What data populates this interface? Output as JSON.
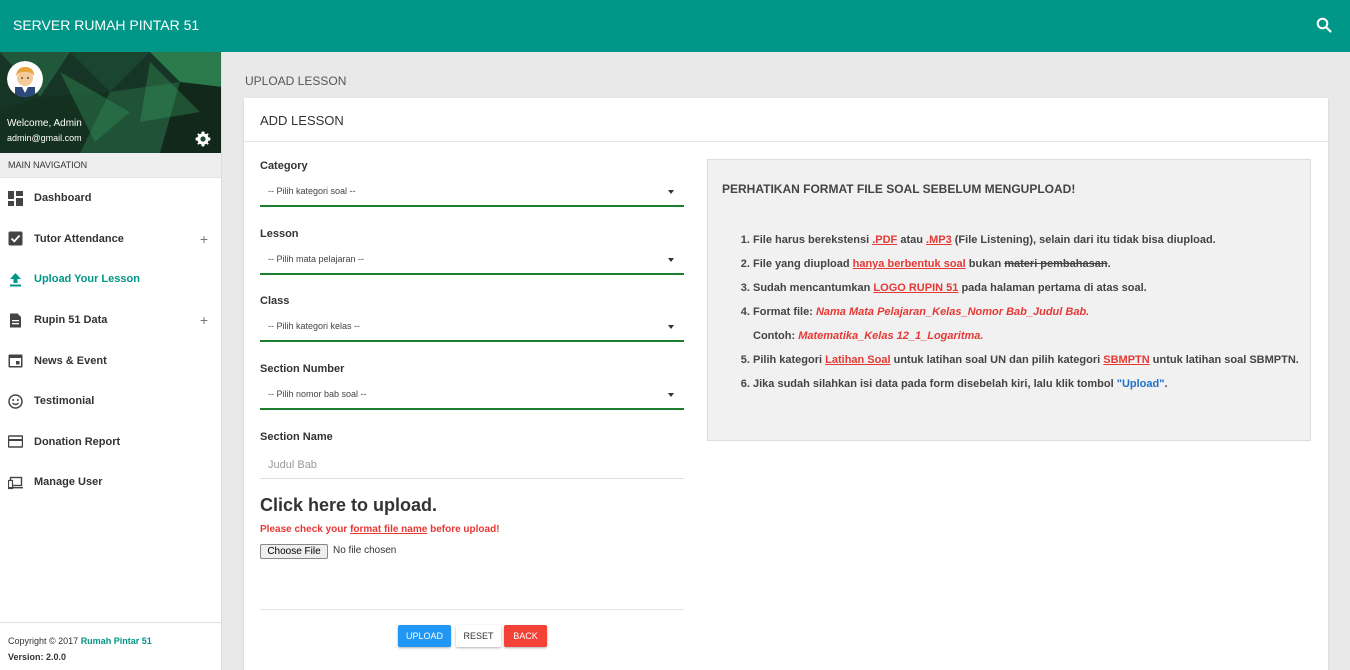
{
  "app": {
    "title": "SERVER RUMAH PINTAR 51"
  },
  "user": {
    "welcome": "Welcome, Admin",
    "email": "admin@gmail.com"
  },
  "nav": {
    "header": "MAIN NAVIGATION",
    "items": [
      {
        "label": "Dashboard",
        "icon": "dashboard-icon",
        "expandable": false
      },
      {
        "label": "Tutor Attendance",
        "icon": "checkbox-icon",
        "expandable": true
      },
      {
        "label": "Upload Your Lesson",
        "icon": "upload-icon",
        "expandable": false,
        "active": true
      },
      {
        "label": "Rupin 51 Data",
        "icon": "document-icon",
        "expandable": true
      },
      {
        "label": "News & Event",
        "icon": "calendar-icon",
        "expandable": false
      },
      {
        "label": "Testimonial",
        "icon": "smiley-icon",
        "expandable": false
      },
      {
        "label": "Donation Report",
        "icon": "card-icon",
        "expandable": false
      },
      {
        "label": "Manage User",
        "icon": "devices-icon",
        "expandable": false
      }
    ],
    "plus": "+"
  },
  "footer": {
    "copyright": "Copyright © 2017 ",
    "brand": "Rumah Pintar 51",
    "version": "Version: 2.0.0"
  },
  "page": {
    "title": "UPLOAD LESSON"
  },
  "card": {
    "title": "ADD LESSON"
  },
  "form": {
    "category_label": "Category",
    "category_value": "-- Pilih kategori soal --",
    "lesson_label": "Lesson",
    "lesson_value": "-- Pilih mata pelajaran --",
    "class_label": "Class",
    "class_value": "-- Pilih kategori kelas --",
    "section_number_label": "Section Number",
    "section_number_value": "-- Pilih nomor bab soal --",
    "section_name_label": "Section Name",
    "section_name_placeholder": "Judul Bab",
    "upload_title": "Click here to upload.",
    "warning_before": "Please check your ",
    "warning_link": "format file name",
    "warning_after": " before upload!",
    "file_button": "Choose File",
    "file_status": "No file chosen",
    "buttons": {
      "upload": "UPLOAD",
      "reset": "RESET",
      "back": "BACK"
    }
  },
  "notice": {
    "title": "PERHATIKAN FORMAT FILE SOAL SEBELUM MENGUPLOAD!",
    "i1": {
      "a": "File harus berekstensi ",
      "b": ".PDF",
      "c": " atau ",
      "d": ".MP3",
      "e": " (File Listening), selain dari itu tidak bisa diupload."
    },
    "i2": {
      "a": "File yang diupload ",
      "b": "hanya berbentuk soal",
      "c": " bukan ",
      "d": "materi pembahasan",
      "e": "."
    },
    "i3": {
      "a": "Sudah mencantumkan ",
      "b": "LOGO RUPIN 51",
      "c": " pada halaman pertama di atas soal."
    },
    "i4": {
      "a": "Format file: ",
      "b": "Nama Mata Pelajaran_Kelas_Nomor Bab_Judul Bab",
      "c": ".",
      "d": "Contoh: ",
      "e": "Matematika_Kelas 12_1_Logaritma",
      "f": "."
    },
    "i5": {
      "a": "Pilih kategori ",
      "b": "Latihan Soal",
      "c": " untuk latihan soal UN dan pilih kategori ",
      "d": "SBMPTN",
      "e": " untuk latihan soal SBMPTN."
    },
    "i6": {
      "a": "Jika sudah silahkan isi data pada form disebelah kiri, lalu klik tombol ",
      "b": "\"Upload\"",
      "c": "."
    }
  }
}
